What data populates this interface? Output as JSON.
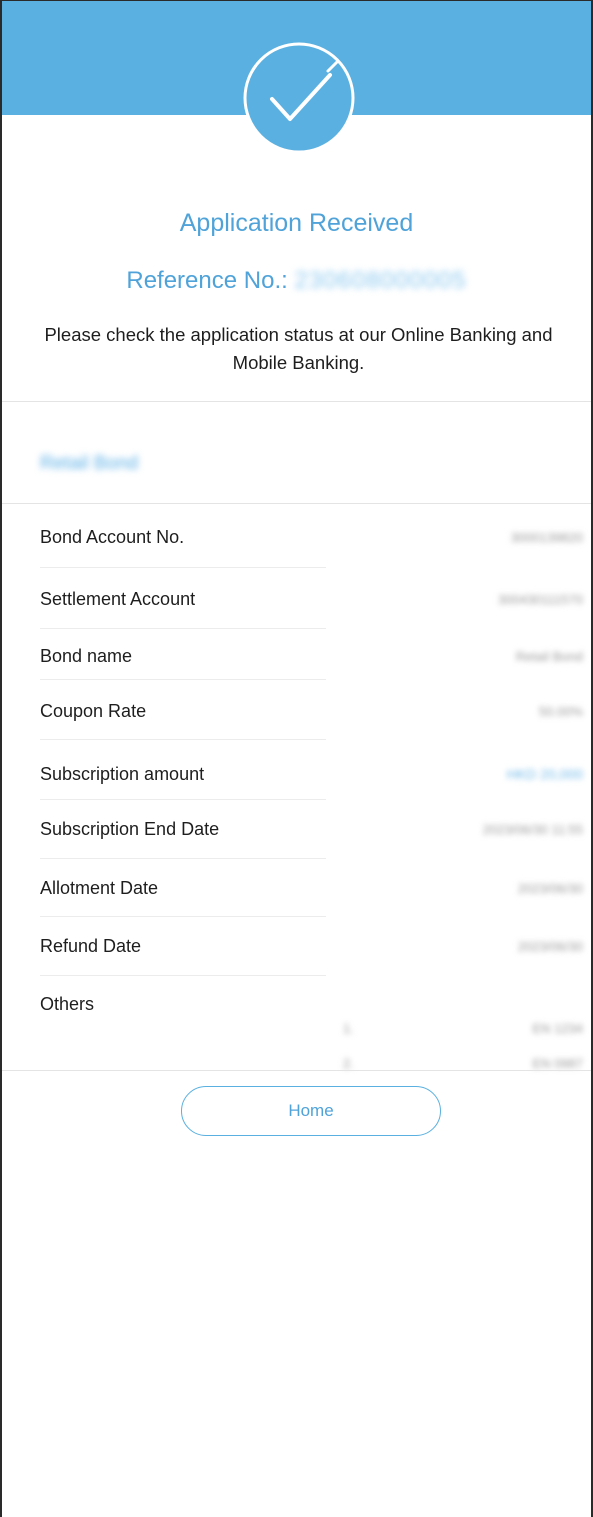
{
  "confirmation": {
    "title": "Application Received",
    "reference_label": "Reference No.:",
    "reference_number": "230608000005",
    "note": "Please check the application status at our Online Banking and Mobile Banking."
  },
  "section": {
    "product_label": "Retail Bond"
  },
  "details": [
    {
      "label": "Bond Account No.",
      "value": "3000139820"
    },
    {
      "label": "Settlement Account",
      "value": "300430111570"
    },
    {
      "label": "Bond name",
      "value": "Retail Bond"
    },
    {
      "label": "Coupon Rate",
      "value": "50.00%"
    },
    {
      "label": "Subscription amount",
      "value": "HKD 20,000"
    },
    {
      "label": "Subscription End Date",
      "value": "2023/06/30 11:55"
    },
    {
      "label": "Allotment Date",
      "value": "2023/06/30"
    },
    {
      "label": "Refund Date",
      "value": "2023/06/30"
    }
  ],
  "others": {
    "label": "Others",
    "items": [
      {
        "index": "1.",
        "value": "EN 1234"
      },
      {
        "index": "2.",
        "value": "EN 0987"
      }
    ]
  },
  "actions": {
    "home_label": "Home"
  },
  "colors": {
    "header_band": "#5ab0e0",
    "accent_text": "#4fa3d9"
  },
  "icons": {
    "status": "checkmark-circle-icon"
  }
}
